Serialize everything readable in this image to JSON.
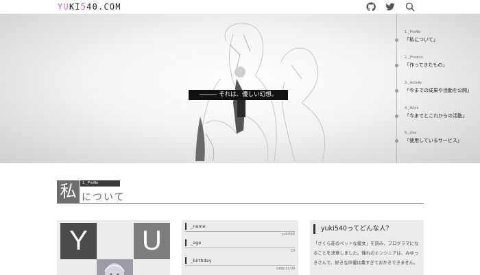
{
  "header": {
    "logo_parts": [
      "Y",
      "U",
      "KI",
      "5",
      "40.COM"
    ],
    "icons": [
      "github-icon",
      "twitter-icon",
      "search-icon"
    ]
  },
  "hero": {
    "tagline": "――― それは、優しい幻想。",
    "timeline": [
      {
        "num": "1._Profile",
        "title": "「私について」"
      },
      {
        "num": "2._Product",
        "title": "「作ってきたもの」"
      },
      {
        "num": "3._Activity",
        "title": "「今までの成果や活動を公開」"
      },
      {
        "num": "4._Work",
        "title": "「今までとこれからの活動」"
      },
      {
        "num": "5._Use",
        "title": "「使用しているサービス」"
      }
    ]
  },
  "section": {
    "kanji": "私",
    "label": "1._Profile",
    "text": "について"
  },
  "profile": {
    "letter_y": "Y",
    "letter_u": "U",
    "fields": [
      {
        "label": "_name",
        "value": "yuki540"
      },
      {
        "label": "_age",
        "value": "20"
      },
      {
        "label": "_birthday",
        "value": "1996/11/09"
      }
    ],
    "about_title": "yuki540ってどんな人？",
    "about_text": "「さくら荘のペットな彼女」を読み、プログラマになることを決意しました。憧れのエンジニアは、みゆっきさんで、好きな声優は桑すぎておかきできません。"
  },
  "colors": {
    "logo_accent": "#d060b0",
    "card_bg": "#ececec",
    "tagline_bg": "#111111"
  }
}
